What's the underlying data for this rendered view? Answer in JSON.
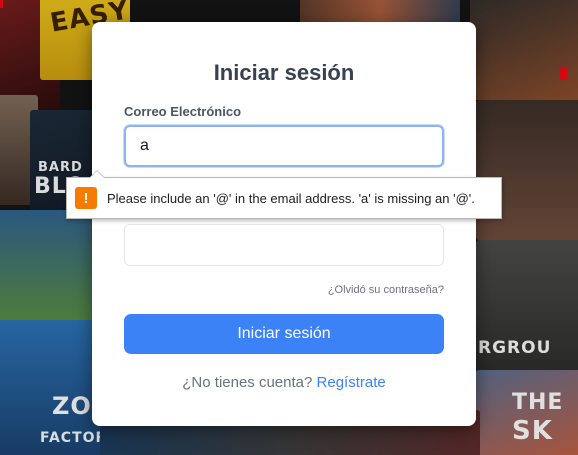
{
  "background": {
    "posters": [
      {
        "text": "EASY"
      },
      {
        "text": "BARD"
      },
      {
        "text": "BLO"
      },
      {
        "text": "ZOO"
      },
      {
        "text": "FACTOR"
      },
      {
        "text": "RGROU"
      },
      {
        "text": "THE"
      },
      {
        "text": "SK"
      }
    ]
  },
  "login": {
    "title": "Iniciar sesión",
    "email_label": "Correo Electrónico",
    "email_value": "a",
    "password_value": "",
    "forgot_link": "¿Olvidó su contraseña?",
    "submit_label": "Iniciar sesión",
    "signup_prompt": "¿No tienes cuenta?",
    "signup_link": "Regístrate"
  },
  "validation": {
    "icon": "warning-icon",
    "message": "Please include an '@' in the email address. 'a' is missing an '@'."
  },
  "colors": {
    "primary": "#3b82f6",
    "warning": "#f57c00"
  }
}
